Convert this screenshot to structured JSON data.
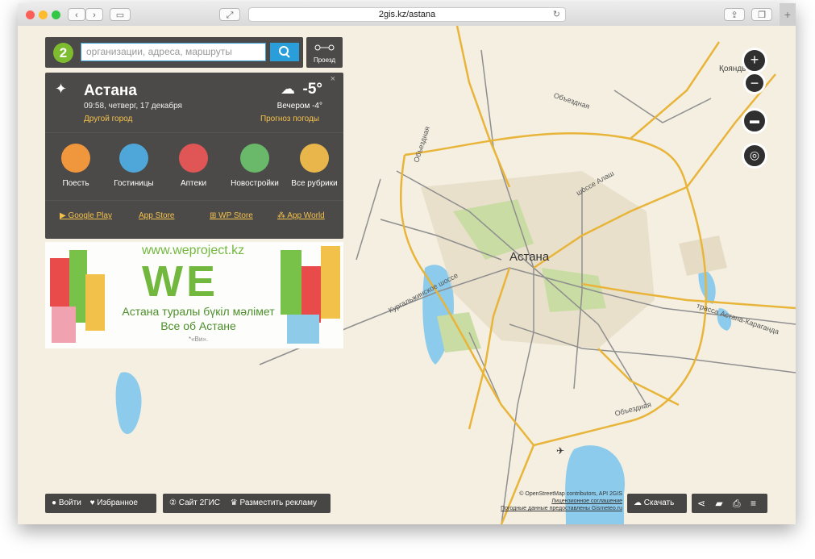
{
  "browser": {
    "url": "2gis.kz/astana"
  },
  "search": {
    "placeholder": "организации, адреса, маршруты",
    "route_label": "Проезд"
  },
  "city": {
    "name": "Астана",
    "date": "09:58, четверг, 17 декабря",
    "change_city": "Другой город",
    "temp": "-5°",
    "evening": "Вечером -4°",
    "forecast": "Прогноз погоды",
    "categories": [
      {
        "label": "Поесть",
        "color": "#f0963c"
      },
      {
        "label": "Гостиницы",
        "color": "#4ea7d8"
      },
      {
        "label": "Аптеки",
        "color": "#e05656"
      },
      {
        "label": "Новостройки",
        "color": "#6ab96a"
      },
      {
        "label": "Все рубрики",
        "color": "#e8b64a"
      }
    ],
    "stores": [
      "Google Play",
      "App Store",
      "WP Store",
      "App World"
    ]
  },
  "ad": {
    "url": "www.weproject.kz",
    "logo": "WE",
    "line1": "Астана туралы бүкіл мәлімет",
    "line2": "Все об Астане",
    "note": "*«Ви»."
  },
  "map": {
    "labels": {
      "city": "Астана",
      "koyandy": "Қояндь",
      "ring_n": "Объездная",
      "ring_w": "Объездная",
      "ring_s": "Объездная",
      "alash": "шоссе Алаш",
      "kurgal": "Кургальжинское шоссе",
      "karaganda": "трасса Астана-Караганда"
    },
    "attribution": [
      "© OpenStreetMap contributors, API 2GIS",
      "Лицензионное соглашение",
      "Погодные данные предоставлены Gismeteo.ru"
    ]
  },
  "bottom": {
    "login": "Войти",
    "favorites": "Избранное",
    "site": "Сайт 2ГИС",
    "advertise": "Разместить рекламу",
    "download": "Скачать"
  }
}
